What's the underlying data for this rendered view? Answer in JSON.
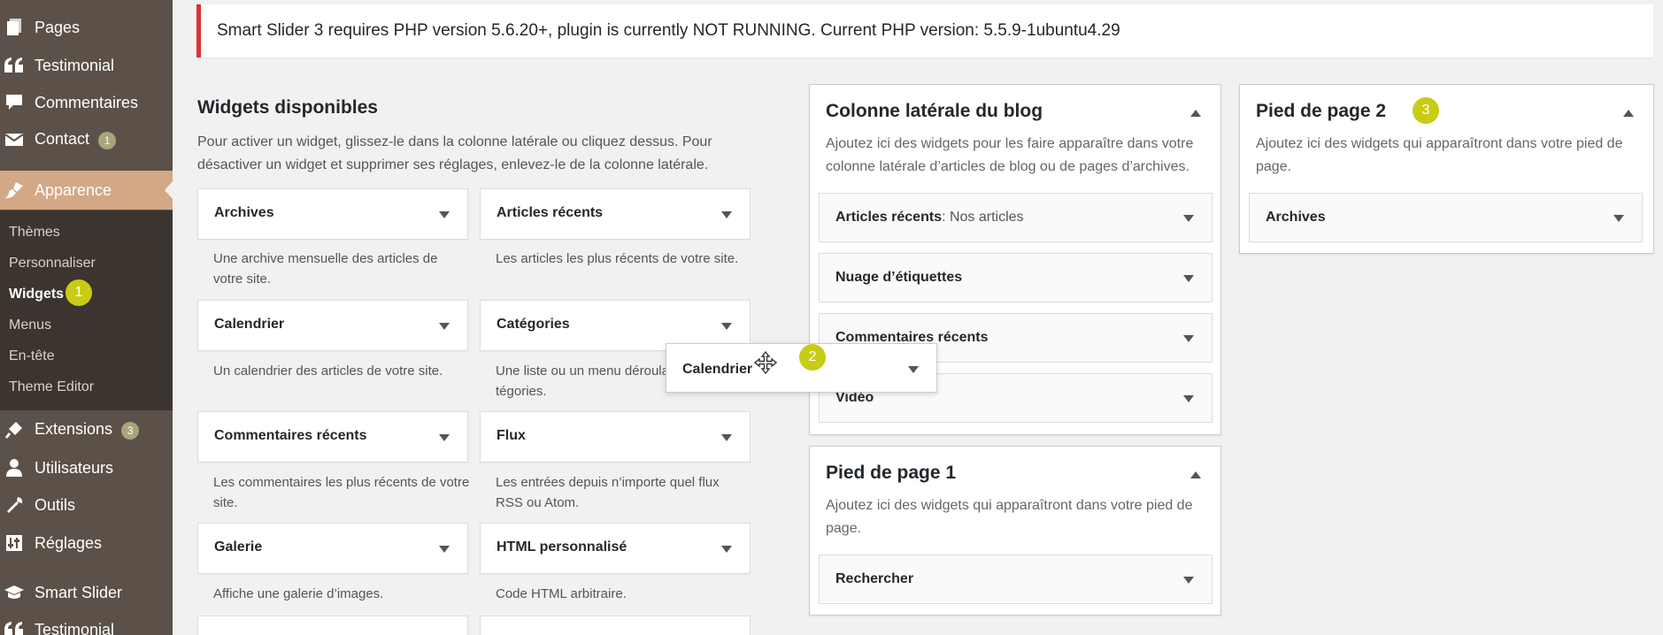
{
  "sidebar": {
    "items": [
      {
        "label": "Pages",
        "icon": "pages-icon"
      },
      {
        "label": "Testimonial",
        "icon": "quote-icon"
      },
      {
        "label": "Commentaires",
        "icon": "comments-icon"
      },
      {
        "label": "Contact",
        "icon": "mail-icon",
        "badge": "1"
      },
      {
        "label": "Apparence",
        "icon": "appearance-brush-icon"
      },
      {
        "label": "Extensions",
        "icon": "plugins-icon",
        "badge": "3"
      },
      {
        "label": "Utilisateurs",
        "icon": "users-icon"
      },
      {
        "label": "Outils",
        "icon": "tools-icon"
      },
      {
        "label": "Réglages",
        "icon": "settings-icon"
      },
      {
        "label": "Smart Slider",
        "icon": "graduation-cap-icon"
      },
      {
        "label": "Testimonial",
        "icon": "quote-icon"
      }
    ],
    "submenu": [
      "Thèmes",
      "Personnaliser",
      "Widgets",
      "Menus",
      "En-tête",
      "Theme Editor"
    ]
  },
  "markers": [
    "1",
    "2",
    "3"
  ],
  "notice": "Smart Slider 3 requires PHP version 5.6.20+, plugin is currently NOT RUNNING. Current PHP version: 5.5.9-1ubuntu4.29",
  "available": {
    "title": "Widgets disponibles",
    "description": "Pour activer un widget, glissez-le dans la colonne latérale ou cliquez dessus. Pour désactiver un widget et supprimer ses réglages, enlevez-le de la colonne latérale.",
    "widgets": [
      {
        "title": "Archives",
        "desc": "Une archive mensuelle des articles de votre site."
      },
      {
        "title": "Articles récents",
        "desc": "Les articles les plus récents de votre site."
      },
      {
        "title": "Calendrier",
        "desc": "Un calendrier des articles de votre site."
      },
      {
        "title": "Catégories",
        "desc": "Une liste ou un menu déroula tégories."
      },
      {
        "title": "Commentaires récents",
        "desc": "Les commentaires les plus récents de votre site."
      },
      {
        "title": "Flux",
        "desc": "Les entrées depuis n’importe quel flux RSS ou Atom."
      },
      {
        "title": "Galerie",
        "desc": "Affiche une galerie d’images."
      },
      {
        "title": "HTML personnalisé",
        "desc": "Code HTML arbitraire."
      }
    ]
  },
  "areas": {
    "blog": {
      "title": "Colonne latérale du blog",
      "desc": "Ajoutez ici des widgets pour les faire apparaître dans votre colonne latérale d’articles de blog ou de pages d’archives.",
      "widgets": [
        {
          "title": "Articles récents",
          "sub": ": Nos articles"
        },
        {
          "title": "Nuage d’étiquettes",
          "sub": ""
        },
        {
          "title": "Commentaires récents",
          "sub": ""
        },
        {
          "title": "Vidéo",
          "sub": ""
        }
      ]
    },
    "footer1": {
      "title": "Pied de page 1",
      "desc": "Ajoutez ici des widgets qui apparaîtront dans votre pied de page.",
      "widgets": [
        {
          "title": "Rechercher"
        }
      ]
    },
    "footer2": {
      "title": "Pied de page 2",
      "desc": "Ajoutez ici des widgets qui apparaîtront dans votre pied de page.",
      "widgets": [
        {
          "title": "Archives"
        }
      ]
    }
  },
  "dragging": {
    "title": "Calendrier"
  }
}
